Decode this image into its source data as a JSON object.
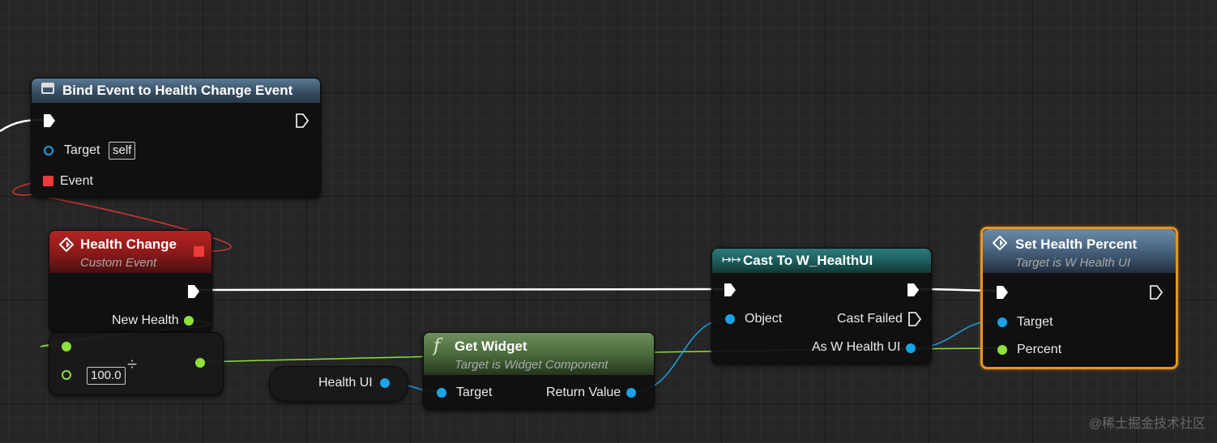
{
  "colors": {
    "exec": "#ffffff",
    "object_pin": "#1aa3e6",
    "float_pin": "#8ee03c",
    "delegate_pin": "#ef3a3a",
    "selection": "#e8961e"
  },
  "nodes": {
    "bind_event": {
      "icon": "function-call-icon",
      "title": "Bind Event to Health Change Event",
      "target_label": "Target",
      "target_default": "self",
      "event_label": "Event"
    },
    "health_change": {
      "icon": "event-diamond-icon",
      "title": "Health Change",
      "subtitle": "Custom Event",
      "new_health_label": "New Health"
    },
    "divide": {
      "operator": "÷",
      "b_value": "100.0"
    },
    "health_ui_var": {
      "label": "Health UI"
    },
    "get_widget": {
      "icon": "function-f-icon",
      "title": "Get Widget",
      "subtitle": "Target is Widget Component",
      "target_label": "Target",
      "return_label": "Return Value"
    },
    "cast": {
      "icon": "cast-arrows-icon",
      "title": "Cast To W_HealthUI",
      "object_label": "Object",
      "cast_failed_label": "Cast Failed",
      "as_label": "As W Health UI"
    },
    "set_health_percent": {
      "icon": "function-diamond-icon",
      "title": "Set Health Percent",
      "subtitle": "Target is W Health UI",
      "target_label": "Target",
      "percent_label": "Percent"
    }
  },
  "watermark": "@稀土掘金技术社区"
}
